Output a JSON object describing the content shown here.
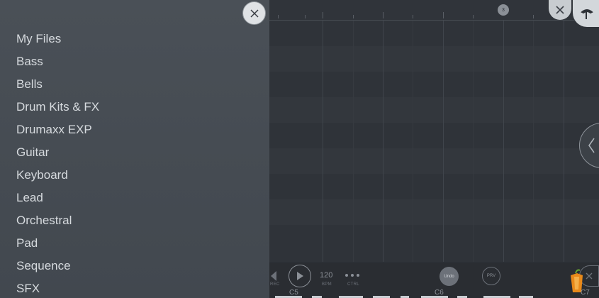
{
  "sidebar": {
    "items": [
      {
        "label": "My Files"
      },
      {
        "label": "Bass"
      },
      {
        "label": "Bells"
      },
      {
        "label": "Drum Kits & FX"
      },
      {
        "label": "Drumaxx EXP"
      },
      {
        "label": "Guitar"
      },
      {
        "label": "Keyboard"
      },
      {
        "label": "Lead"
      },
      {
        "label": "Orchestral"
      },
      {
        "label": "Pad"
      },
      {
        "label": "Sequence"
      },
      {
        "label": "SFX"
      }
    ],
    "close_icon": "close-icon"
  },
  "timeline": {
    "marker": "3"
  },
  "transport": {
    "tempo": "120",
    "tempo_label": "BPM",
    "ctrl_label": "CTRL",
    "rec_label": "REC",
    "undo_label": "Undo",
    "prv_label": "PRV"
  },
  "keyboard": {
    "labels": [
      "C5",
      "C6",
      "C7"
    ]
  },
  "colors": {
    "sidebar": "#474d54",
    "editor": "#2d3137",
    "text": "#d6dade",
    "accent": "#f39c12"
  }
}
